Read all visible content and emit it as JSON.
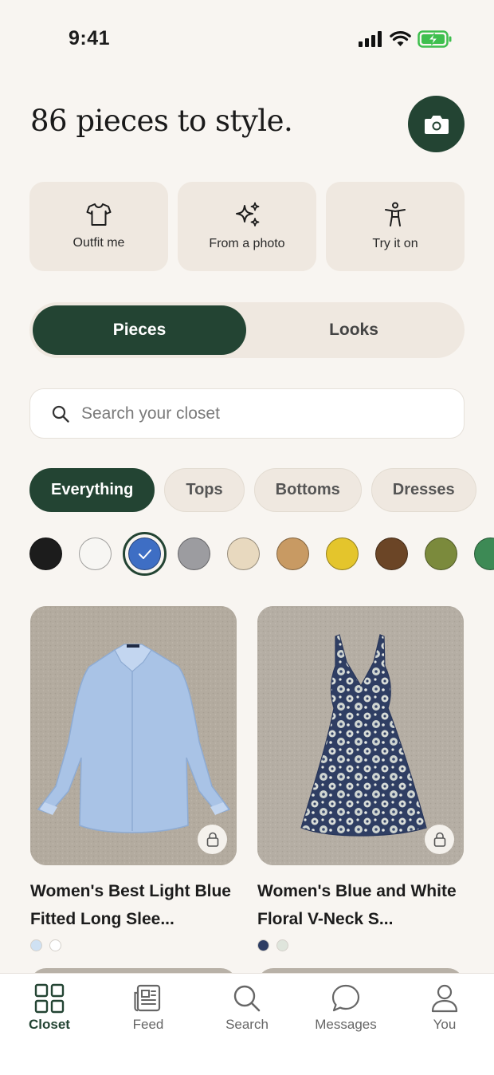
{
  "status_bar": {
    "time": "9:41"
  },
  "header": {
    "headline": "86 pieces to style."
  },
  "actions": [
    {
      "label": "Outfit me",
      "icon": "tshirt-icon"
    },
    {
      "label": "From a photo",
      "icon": "sparkles-icon"
    },
    {
      "label": "Try it on",
      "icon": "person-icon"
    }
  ],
  "segment": {
    "active": "Pieces",
    "inactive": "Looks"
  },
  "search": {
    "placeholder": "Search your closet"
  },
  "filters": [
    "Everything",
    "Tops",
    "Bottoms",
    "Dresses"
  ],
  "colors": [
    "#1c1c1c",
    "#f7f6f3",
    "#3e6ec4",
    "#9c9ca0",
    "#e8d9bf",
    "#c89a63",
    "#e4c52c",
    "#6b4526",
    "#7b8a3c",
    "#3d8a55"
  ],
  "selected_color_index": 2,
  "items": [
    {
      "title": "Women's Best Light Blue Fitted Long Slee...",
      "colors": [
        "#cfe1f3",
        "#ffffff"
      ]
    },
    {
      "title": "Women's Blue and White Floral V-Neck S...",
      "colors": [
        "#2d3d63",
        "#dfe5dc"
      ]
    }
  ],
  "tabs": [
    {
      "label": "Closet",
      "icon": "grid-icon",
      "active": true
    },
    {
      "label": "Feed",
      "icon": "newspaper-icon",
      "active": false
    },
    {
      "label": "Search",
      "icon": "search-icon",
      "active": false
    },
    {
      "label": "Messages",
      "icon": "chat-bubble-icon",
      "active": false
    },
    {
      "label": "You",
      "icon": "user-icon",
      "active": false
    }
  ],
  "accent_color": "#234433"
}
